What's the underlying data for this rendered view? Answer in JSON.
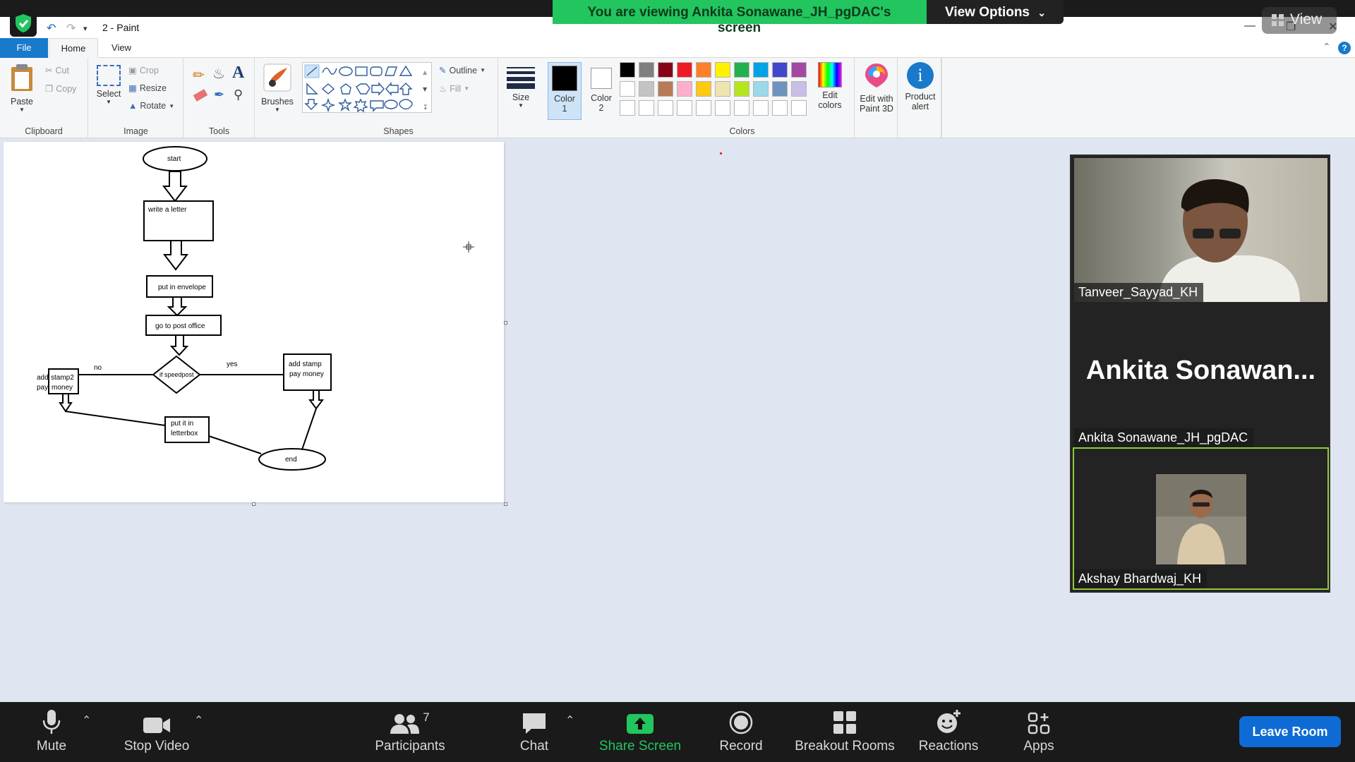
{
  "zoom": {
    "banner_text": "You are viewing Ankita Sonawane_JH_pgDAC's screen",
    "view_options_label": "View Options",
    "view_pill_label": "View"
  },
  "paint": {
    "title": "2 - Paint",
    "tabs": [
      "File",
      "Home",
      "View"
    ],
    "clipboard": {
      "paste": "Paste",
      "cut": "Cut",
      "copy": "Copy",
      "group": "Clipboard"
    },
    "image": {
      "select": "Select",
      "crop": "Crop",
      "resize": "Resize",
      "rotate": "Rotate",
      "group": "Image"
    },
    "tools": {
      "group": "Tools",
      "text_glyph": "A"
    },
    "brushes": {
      "label": "Brushes"
    },
    "shapes": {
      "outline": "Outline",
      "fill": "Fill",
      "group": "Shapes"
    },
    "size": {
      "label": "Size"
    },
    "colors": {
      "color1": "Color",
      "color1_num": "1",
      "color2": "Color",
      "color2_num": "2",
      "edit_colors_1": "Edit",
      "edit_colors_2": "colors",
      "group": "Colors",
      "color1_value": "#000000",
      "color2_value": "#ffffff",
      "palette_row1": [
        "#000000",
        "#7f7f7f",
        "#880015",
        "#ed1c24",
        "#ff7f27",
        "#fff200",
        "#22b14c",
        "#00a2e8",
        "#3f48cc",
        "#a349a4"
      ],
      "palette_row2": [
        "#ffffff",
        "#c3c3c3",
        "#b97a57",
        "#ffaec9",
        "#ffc90e",
        "#efe4b0",
        "#b5e61d",
        "#99d9ea",
        "#7092be",
        "#c8bfe7"
      ],
      "palette_row3": [
        "#ffffff",
        "#ffffff",
        "#ffffff",
        "#ffffff",
        "#ffffff",
        "#ffffff",
        "#ffffff",
        "#ffffff",
        "#ffffff",
        "#ffffff"
      ]
    },
    "paint3d": {
      "line1": "Edit with",
      "line2": "Paint 3D"
    },
    "product_alert": {
      "line1": "Product",
      "line2": "alert"
    }
  },
  "flowchart": {
    "start": "start",
    "write": "write a letter",
    "envelope": "put in envelope",
    "post_office": "go to post office",
    "decision": "if speedpost",
    "yes": "yes",
    "no": "no",
    "add_stamp_1": "add stamp",
    "add_stamp_2": "pay money",
    "left_box_1": "stamp2",
    "left_box_2": "money",
    "left_over_1": "add",
    "left_over_2": "pay",
    "letterbox_1": "put it in",
    "letterbox_2": "letterbox",
    "end": "end"
  },
  "participants_panel": {
    "tiles": [
      {
        "name": "Tanveer_Sayyad_KH"
      },
      {
        "name": "Ankita Sonawane_JH_pgDAC",
        "big_name": "Ankita  Sonawan..."
      },
      {
        "name": "Akshay Bhardwaj_KH"
      }
    ]
  },
  "toolbar": {
    "mute": "Mute",
    "stop_video": "Stop Video",
    "participants": "Participants",
    "participants_count": "7",
    "chat": "Chat",
    "share_screen": "Share Screen",
    "record": "Record",
    "breakout_rooms": "Breakout Rooms",
    "reactions": "Reactions",
    "apps": "Apps",
    "leave_room": "Leave Room"
  }
}
